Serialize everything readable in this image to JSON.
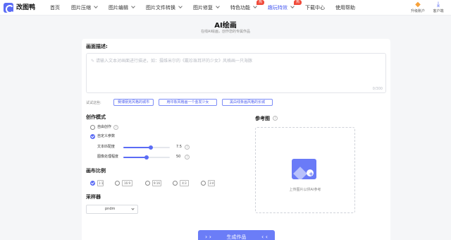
{
  "brand": {
    "name": "改图鸭"
  },
  "nav": {
    "items": [
      {
        "label": "首页"
      },
      {
        "label": "图片压缩"
      },
      {
        "label": "图片编辑"
      },
      {
        "label": "图片文件转换"
      },
      {
        "label": "图片修复"
      },
      {
        "label": "特色功能"
      },
      {
        "label": "趣玩特效"
      },
      {
        "label": "下载中心"
      },
      {
        "label": "使用帮助"
      }
    ],
    "hot_badge": "热",
    "upgrade_label": "升级账户",
    "client_label": "客户端"
  },
  "page": {
    "title": "AI绘画",
    "subtitle": "在线AI绘画，创作您的专属作品"
  },
  "prompt": {
    "label": "画面描述:",
    "placeholder": "请输入文本对画面进行描述，如：摄维米尔的《戴珍珠耳环的少女》风格画一只海豚",
    "counter": "0/300",
    "try_label": "试试这些:",
    "suggestions": [
      "赛博朋克风格的城市",
      "用印象风格画一个金发少女",
      "黑白线条画风格的长城"
    ]
  },
  "mode": {
    "label": "创作模式",
    "free_label": "自由创作",
    "custom_label": "自定义参数",
    "text_match_label": "文本匹配度",
    "text_match_value": "7.5",
    "text_match_fraction": 0.59,
    "image_label": "图像处理程度",
    "image_value": "50",
    "image_fraction": 0.5
  },
  "ratio": {
    "label": "画布比例",
    "options": [
      "1:1",
      "16:9",
      "9:16",
      "4:3",
      "3:4"
    ],
    "selected": "1:1"
  },
  "sampler": {
    "label": "采样器",
    "value": "pndm"
  },
  "reference": {
    "label": "参考图",
    "upload_text": "上传图片以供AI参考"
  },
  "generate": {
    "label": "生成作品"
  },
  "colors": {
    "accent": "#5b6cf5",
    "hot": "#f04a3a"
  }
}
